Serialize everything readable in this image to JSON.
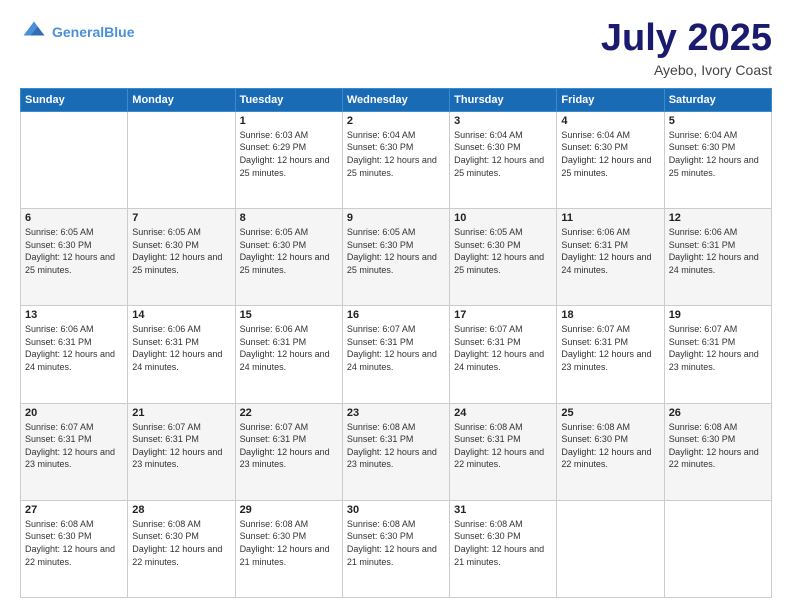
{
  "header": {
    "logo_line1": "General",
    "logo_line2": "Blue",
    "month": "July 2025",
    "location": "Ayebo, Ivory Coast"
  },
  "weekdays": [
    "Sunday",
    "Monday",
    "Tuesday",
    "Wednesday",
    "Thursday",
    "Friday",
    "Saturday"
  ],
  "weeks": [
    [
      {
        "day": "",
        "info": ""
      },
      {
        "day": "",
        "info": ""
      },
      {
        "day": "1",
        "info": "Sunrise: 6:03 AM\nSunset: 6:29 PM\nDaylight: 12 hours and 25 minutes."
      },
      {
        "day": "2",
        "info": "Sunrise: 6:04 AM\nSunset: 6:30 PM\nDaylight: 12 hours and 25 minutes."
      },
      {
        "day": "3",
        "info": "Sunrise: 6:04 AM\nSunset: 6:30 PM\nDaylight: 12 hours and 25 minutes."
      },
      {
        "day": "4",
        "info": "Sunrise: 6:04 AM\nSunset: 6:30 PM\nDaylight: 12 hours and 25 minutes."
      },
      {
        "day": "5",
        "info": "Sunrise: 6:04 AM\nSunset: 6:30 PM\nDaylight: 12 hours and 25 minutes."
      }
    ],
    [
      {
        "day": "6",
        "info": "Sunrise: 6:05 AM\nSunset: 6:30 PM\nDaylight: 12 hours and 25 minutes."
      },
      {
        "day": "7",
        "info": "Sunrise: 6:05 AM\nSunset: 6:30 PM\nDaylight: 12 hours and 25 minutes."
      },
      {
        "day": "8",
        "info": "Sunrise: 6:05 AM\nSunset: 6:30 PM\nDaylight: 12 hours and 25 minutes."
      },
      {
        "day": "9",
        "info": "Sunrise: 6:05 AM\nSunset: 6:30 PM\nDaylight: 12 hours and 25 minutes."
      },
      {
        "day": "10",
        "info": "Sunrise: 6:05 AM\nSunset: 6:30 PM\nDaylight: 12 hours and 25 minutes."
      },
      {
        "day": "11",
        "info": "Sunrise: 6:06 AM\nSunset: 6:31 PM\nDaylight: 12 hours and 24 minutes."
      },
      {
        "day": "12",
        "info": "Sunrise: 6:06 AM\nSunset: 6:31 PM\nDaylight: 12 hours and 24 minutes."
      }
    ],
    [
      {
        "day": "13",
        "info": "Sunrise: 6:06 AM\nSunset: 6:31 PM\nDaylight: 12 hours and 24 minutes."
      },
      {
        "day": "14",
        "info": "Sunrise: 6:06 AM\nSunset: 6:31 PM\nDaylight: 12 hours and 24 minutes."
      },
      {
        "day": "15",
        "info": "Sunrise: 6:06 AM\nSunset: 6:31 PM\nDaylight: 12 hours and 24 minutes."
      },
      {
        "day": "16",
        "info": "Sunrise: 6:07 AM\nSunset: 6:31 PM\nDaylight: 12 hours and 24 minutes."
      },
      {
        "day": "17",
        "info": "Sunrise: 6:07 AM\nSunset: 6:31 PM\nDaylight: 12 hours and 24 minutes."
      },
      {
        "day": "18",
        "info": "Sunrise: 6:07 AM\nSunset: 6:31 PM\nDaylight: 12 hours and 23 minutes."
      },
      {
        "day": "19",
        "info": "Sunrise: 6:07 AM\nSunset: 6:31 PM\nDaylight: 12 hours and 23 minutes."
      }
    ],
    [
      {
        "day": "20",
        "info": "Sunrise: 6:07 AM\nSunset: 6:31 PM\nDaylight: 12 hours and 23 minutes."
      },
      {
        "day": "21",
        "info": "Sunrise: 6:07 AM\nSunset: 6:31 PM\nDaylight: 12 hours and 23 minutes."
      },
      {
        "day": "22",
        "info": "Sunrise: 6:07 AM\nSunset: 6:31 PM\nDaylight: 12 hours and 23 minutes."
      },
      {
        "day": "23",
        "info": "Sunrise: 6:08 AM\nSunset: 6:31 PM\nDaylight: 12 hours and 23 minutes."
      },
      {
        "day": "24",
        "info": "Sunrise: 6:08 AM\nSunset: 6:31 PM\nDaylight: 12 hours and 22 minutes."
      },
      {
        "day": "25",
        "info": "Sunrise: 6:08 AM\nSunset: 6:30 PM\nDaylight: 12 hours and 22 minutes."
      },
      {
        "day": "26",
        "info": "Sunrise: 6:08 AM\nSunset: 6:30 PM\nDaylight: 12 hours and 22 minutes."
      }
    ],
    [
      {
        "day": "27",
        "info": "Sunrise: 6:08 AM\nSunset: 6:30 PM\nDaylight: 12 hours and 22 minutes."
      },
      {
        "day": "28",
        "info": "Sunrise: 6:08 AM\nSunset: 6:30 PM\nDaylight: 12 hours and 22 minutes."
      },
      {
        "day": "29",
        "info": "Sunrise: 6:08 AM\nSunset: 6:30 PM\nDaylight: 12 hours and 21 minutes."
      },
      {
        "day": "30",
        "info": "Sunrise: 6:08 AM\nSunset: 6:30 PM\nDaylight: 12 hours and 21 minutes."
      },
      {
        "day": "31",
        "info": "Sunrise: 6:08 AM\nSunset: 6:30 PM\nDaylight: 12 hours and 21 minutes."
      },
      {
        "day": "",
        "info": ""
      },
      {
        "day": "",
        "info": ""
      }
    ]
  ]
}
